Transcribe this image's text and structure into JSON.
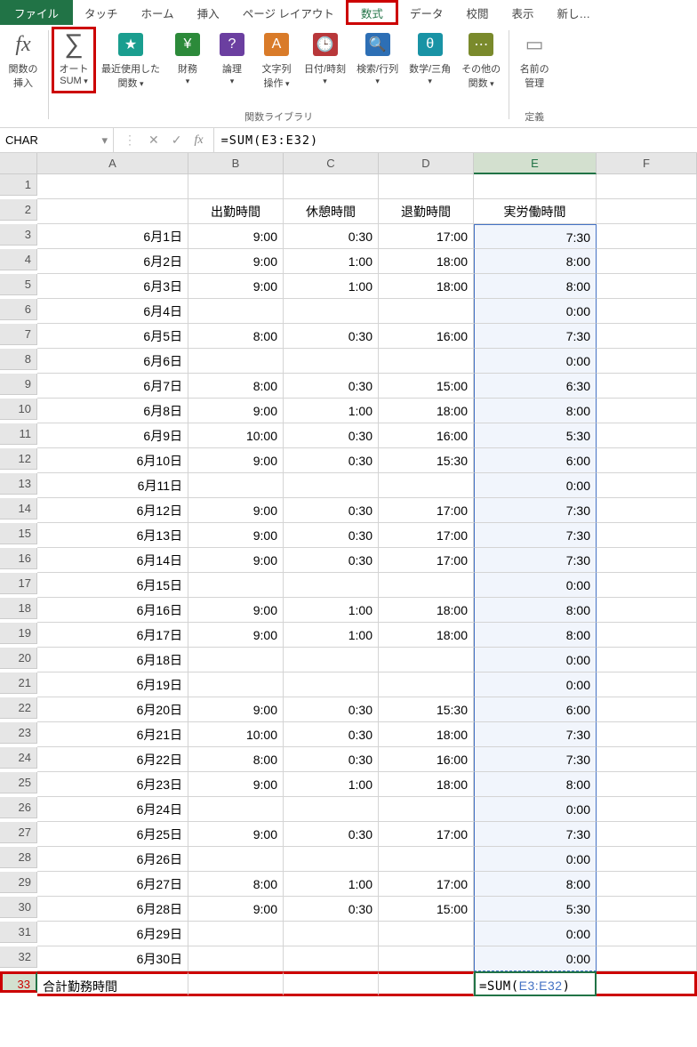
{
  "tabs": {
    "file": "ファイル",
    "touch": "タッチ",
    "home": "ホーム",
    "insert": "挿入",
    "page_layout": "ページ レイアウト",
    "formulas": "数式",
    "data": "データ",
    "review": "校閲",
    "view": "表示",
    "new": "新し…"
  },
  "ribbon": {
    "insert_fn_l1": "関数の",
    "insert_fn_l2": "挿入",
    "autosum_l1": "オート",
    "autosum_l2": "SUM",
    "recent_l1": "最近使用した",
    "recent_l2": "関数",
    "financial": "財務",
    "logical": "論理",
    "text_l1": "文字列",
    "text_l2": "操作",
    "datetime": "日付/時刻",
    "lookup": "検索/行列",
    "math": "数学/三角",
    "other_l1": "その他の",
    "other_l2": "関数",
    "group_library": "関数ライブラリ",
    "name_mgr_l1": "名前の",
    "name_mgr_l2": "管理",
    "group_defined": "定義"
  },
  "formula_bar": {
    "name_box": "CHAR",
    "formula": "=SUM(E3:E32)"
  },
  "columns": [
    "A",
    "B",
    "C",
    "D",
    "E",
    "F"
  ],
  "headers": {
    "b": "出勤時間",
    "c": "休憩時間",
    "d": "退勤時間",
    "e": "実労働時間"
  },
  "rows": [
    {
      "n": 3,
      "a": "6月1日",
      "b": "9:00",
      "c": "0:30",
      "d": "17:00",
      "e": "7:30"
    },
    {
      "n": 4,
      "a": "6月2日",
      "b": "9:00",
      "c": "1:00",
      "d": "18:00",
      "e": "8:00"
    },
    {
      "n": 5,
      "a": "6月3日",
      "b": "9:00",
      "c": "1:00",
      "d": "18:00",
      "e": "8:00"
    },
    {
      "n": 6,
      "a": "6月4日",
      "b": "",
      "c": "",
      "d": "",
      "e": "0:00"
    },
    {
      "n": 7,
      "a": "6月5日",
      "b": "8:00",
      "c": "0:30",
      "d": "16:00",
      "e": "7:30"
    },
    {
      "n": 8,
      "a": "6月6日",
      "b": "",
      "c": "",
      "d": "",
      "e": "0:00"
    },
    {
      "n": 9,
      "a": "6月7日",
      "b": "8:00",
      "c": "0:30",
      "d": "15:00",
      "e": "6:30"
    },
    {
      "n": 10,
      "a": "6月8日",
      "b": "9:00",
      "c": "1:00",
      "d": "18:00",
      "e": "8:00"
    },
    {
      "n": 11,
      "a": "6月9日",
      "b": "10:00",
      "c": "0:30",
      "d": "16:00",
      "e": "5:30"
    },
    {
      "n": 12,
      "a": "6月10日",
      "b": "9:00",
      "c": "0:30",
      "d": "15:30",
      "e": "6:00"
    },
    {
      "n": 13,
      "a": "6月11日",
      "b": "",
      "c": "",
      "d": "",
      "e": "0:00"
    },
    {
      "n": 14,
      "a": "6月12日",
      "b": "9:00",
      "c": "0:30",
      "d": "17:00",
      "e": "7:30"
    },
    {
      "n": 15,
      "a": "6月13日",
      "b": "9:00",
      "c": "0:30",
      "d": "17:00",
      "e": "7:30"
    },
    {
      "n": 16,
      "a": "6月14日",
      "b": "9:00",
      "c": "0:30",
      "d": "17:00",
      "e": "7:30"
    },
    {
      "n": 17,
      "a": "6月15日",
      "b": "",
      "c": "",
      "d": "",
      "e": "0:00"
    },
    {
      "n": 18,
      "a": "6月16日",
      "b": "9:00",
      "c": "1:00",
      "d": "18:00",
      "e": "8:00"
    },
    {
      "n": 19,
      "a": "6月17日",
      "b": "9:00",
      "c": "1:00",
      "d": "18:00",
      "e": "8:00"
    },
    {
      "n": 20,
      "a": "6月18日",
      "b": "",
      "c": "",
      "d": "",
      "e": "0:00"
    },
    {
      "n": 21,
      "a": "6月19日",
      "b": "",
      "c": "",
      "d": "",
      "e": "0:00"
    },
    {
      "n": 22,
      "a": "6月20日",
      "b": "9:00",
      "c": "0:30",
      "d": "15:30",
      "e": "6:00"
    },
    {
      "n": 23,
      "a": "6月21日",
      "b": "10:00",
      "c": "0:30",
      "d": "18:00",
      "e": "7:30"
    },
    {
      "n": 24,
      "a": "6月22日",
      "b": "8:00",
      "c": "0:30",
      "d": "16:00",
      "e": "7:30"
    },
    {
      "n": 25,
      "a": "6月23日",
      "b": "9:00",
      "c": "1:00",
      "d": "18:00",
      "e": "8:00"
    },
    {
      "n": 26,
      "a": "6月24日",
      "b": "",
      "c": "",
      "d": "",
      "e": "0:00"
    },
    {
      "n": 27,
      "a": "6月25日",
      "b": "9:00",
      "c": "0:30",
      "d": "17:00",
      "e": "7:30"
    },
    {
      "n": 28,
      "a": "6月26日",
      "b": "",
      "c": "",
      "d": "",
      "e": "0:00"
    },
    {
      "n": 29,
      "a": "6月27日",
      "b": "8:00",
      "c": "1:00",
      "d": "17:00",
      "e": "8:00"
    },
    {
      "n": 30,
      "a": "6月28日",
      "b": "9:00",
      "c": "0:30",
      "d": "15:00",
      "e": "5:30"
    },
    {
      "n": 31,
      "a": "6月29日",
      "b": "",
      "c": "",
      "d": "",
      "e": "0:00"
    },
    {
      "n": 32,
      "a": "6月30日",
      "b": "",
      "c": "",
      "d": "",
      "e": "0:00"
    }
  ],
  "sum_row": {
    "n": 33,
    "a": "合計勤務時間",
    "e_plain": "=SUM(",
    "e_ref": "E3:E32",
    "e_close": ")"
  }
}
